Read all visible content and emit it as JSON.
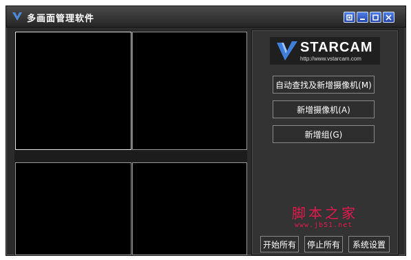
{
  "window": {
    "title": "多画面管理软件"
  },
  "logo": {
    "brand": "STARCAM",
    "url": "http://www.vstarcam.com"
  },
  "panel": {
    "buttons": [
      {
        "label": "自动查找及新增摄像机(M)"
      },
      {
        "label": "新增摄像机(A)"
      },
      {
        "label": "新增组(G)"
      }
    ],
    "bottom_buttons": [
      {
        "label": "开始所有"
      },
      {
        "label": "停止所有"
      },
      {
        "label": "系统设置"
      }
    ]
  },
  "watermark": {
    "text": "脚本之家",
    "url": "www.jb51.net"
  },
  "colors": {
    "title_bar": "#262626",
    "control_blue": "#2f56c6",
    "watermark": "#e01a4f"
  },
  "icons": [
    "app-logo-icon",
    "restore-icon",
    "minimize-icon",
    "maximize-icon",
    "close-icon"
  ]
}
